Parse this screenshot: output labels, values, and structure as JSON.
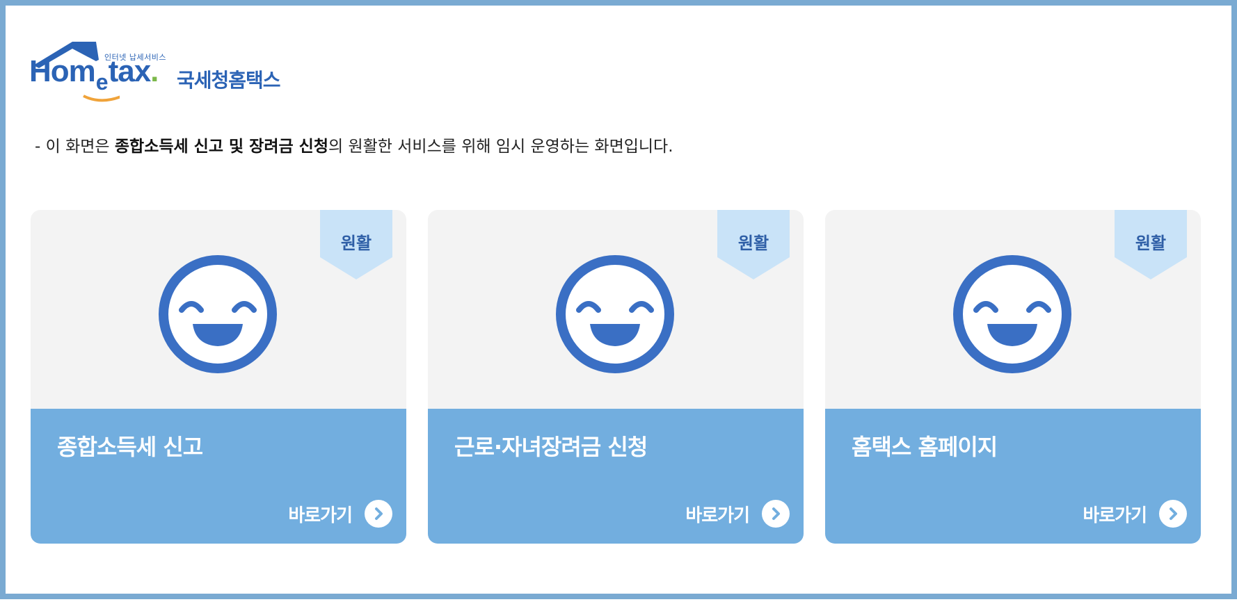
{
  "logo": {
    "small_text": "인터넷 납세서비스",
    "brand_hom": "Hom",
    "brand_e": "e",
    "brand_tax": "tax",
    "brand_dot": ".",
    "korean_name": "국세청홈택스"
  },
  "notice": {
    "prefix": "- 이 화면은 ",
    "bold": "종합소득세 신고 및 장려금 신청",
    "suffix": "의 원활한 서비스를 위해 임시 운영하는 화면입니다."
  },
  "cards": [
    {
      "badge": "원활",
      "title": "종합소득세 신고",
      "link_label": "바로가기",
      "status_icon": "smile-icon"
    },
    {
      "badge": "원활",
      "title": "근로·자녀장려금 신청",
      "link_label": "바로가기",
      "status_icon": "smile-icon"
    },
    {
      "badge": "원활",
      "title": "홈택스 홈페이지",
      "link_label": "바로가기",
      "status_icon": "smile-icon"
    }
  ],
  "colors": {
    "frame_border": "#7aaad2",
    "brand_blue": "#2b63b5",
    "card_top_bg": "#f3f3f3",
    "card_bottom_bg": "#72aedf",
    "ribbon_bg": "#c9e3f8",
    "face_blue": "#3a6fc4"
  }
}
